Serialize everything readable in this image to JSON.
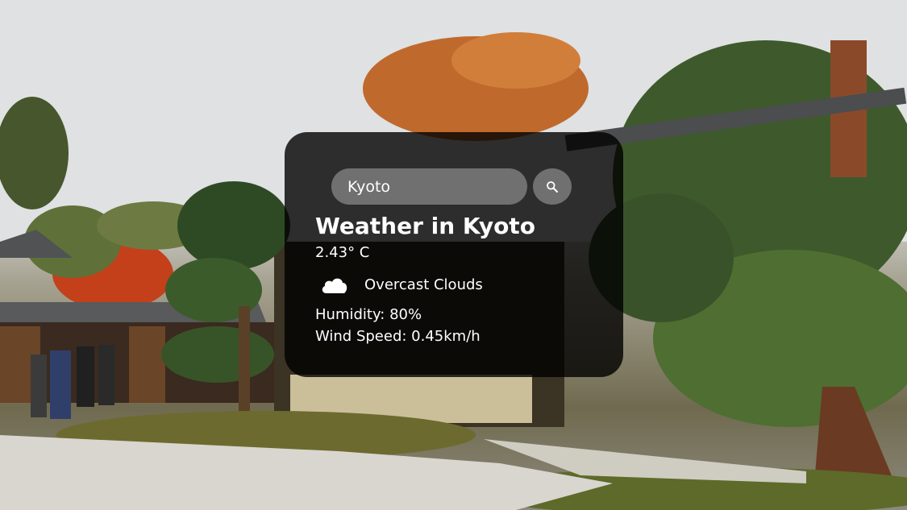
{
  "search": {
    "value": "Kyoto",
    "icon": "search-icon"
  },
  "weather": {
    "title": "Weather in Kyoto",
    "temperature": "2.43° C",
    "condition": "Overcast Clouds",
    "condition_icon": "cloud-icon",
    "humidity": "Humidity: 80%",
    "wind": "Wind Speed: 0.45km/h"
  },
  "colors": {
    "card_background": "#000000cc",
    "input_background": "#7c7c7c",
    "text": "#ffffff"
  }
}
